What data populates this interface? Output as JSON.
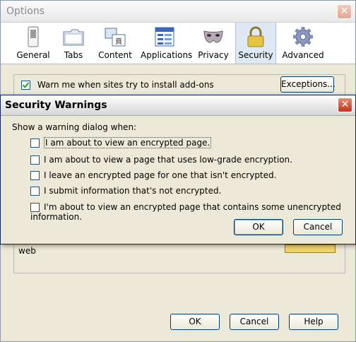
{
  "window": {
    "title": "Options",
    "close_label": "✕"
  },
  "toolbar": {
    "items": [
      {
        "label": "General",
        "icon": "switch-icon"
      },
      {
        "label": "Tabs",
        "icon": "folder-tabs-icon"
      },
      {
        "label": "Content",
        "icon": "content-icon"
      },
      {
        "label": "Applications",
        "icon": "applications-icon"
      },
      {
        "label": "Privacy",
        "icon": "mask-icon"
      },
      {
        "label": "Security",
        "icon": "padlock-icon",
        "selected": true
      },
      {
        "label": "Advanced",
        "icon": "gear-icon"
      }
    ]
  },
  "security": {
    "addons_label": "Warn me when sites try to install add-ons",
    "addons_checked": true,
    "exceptions_label": "Exceptions...",
    "web_label": "web"
  },
  "footer": {
    "ok": "OK",
    "cancel": "Cancel",
    "help": "Help"
  },
  "dialog": {
    "title": "Security Warnings",
    "close_label": "✕",
    "prompt": "Show a warning dialog when:",
    "options": [
      {
        "label": "I am about to view an encrypted page.",
        "checked": false
      },
      {
        "label": "I am about to view a page that uses low-grade encryption.",
        "checked": false
      },
      {
        "label": "I leave an encrypted page for one that isn't encrypted.",
        "checked": false
      },
      {
        "label": "I submit information that's not encrypted.",
        "checked": false
      },
      {
        "label": "I'm about to view an encrypted page that contains some unencrypted information.",
        "checked": false
      }
    ],
    "ok": "OK",
    "cancel": "Cancel"
  },
  "colors": {
    "selected_tab": "#dfe9f6",
    "dialog_close": "#c5321d"
  }
}
